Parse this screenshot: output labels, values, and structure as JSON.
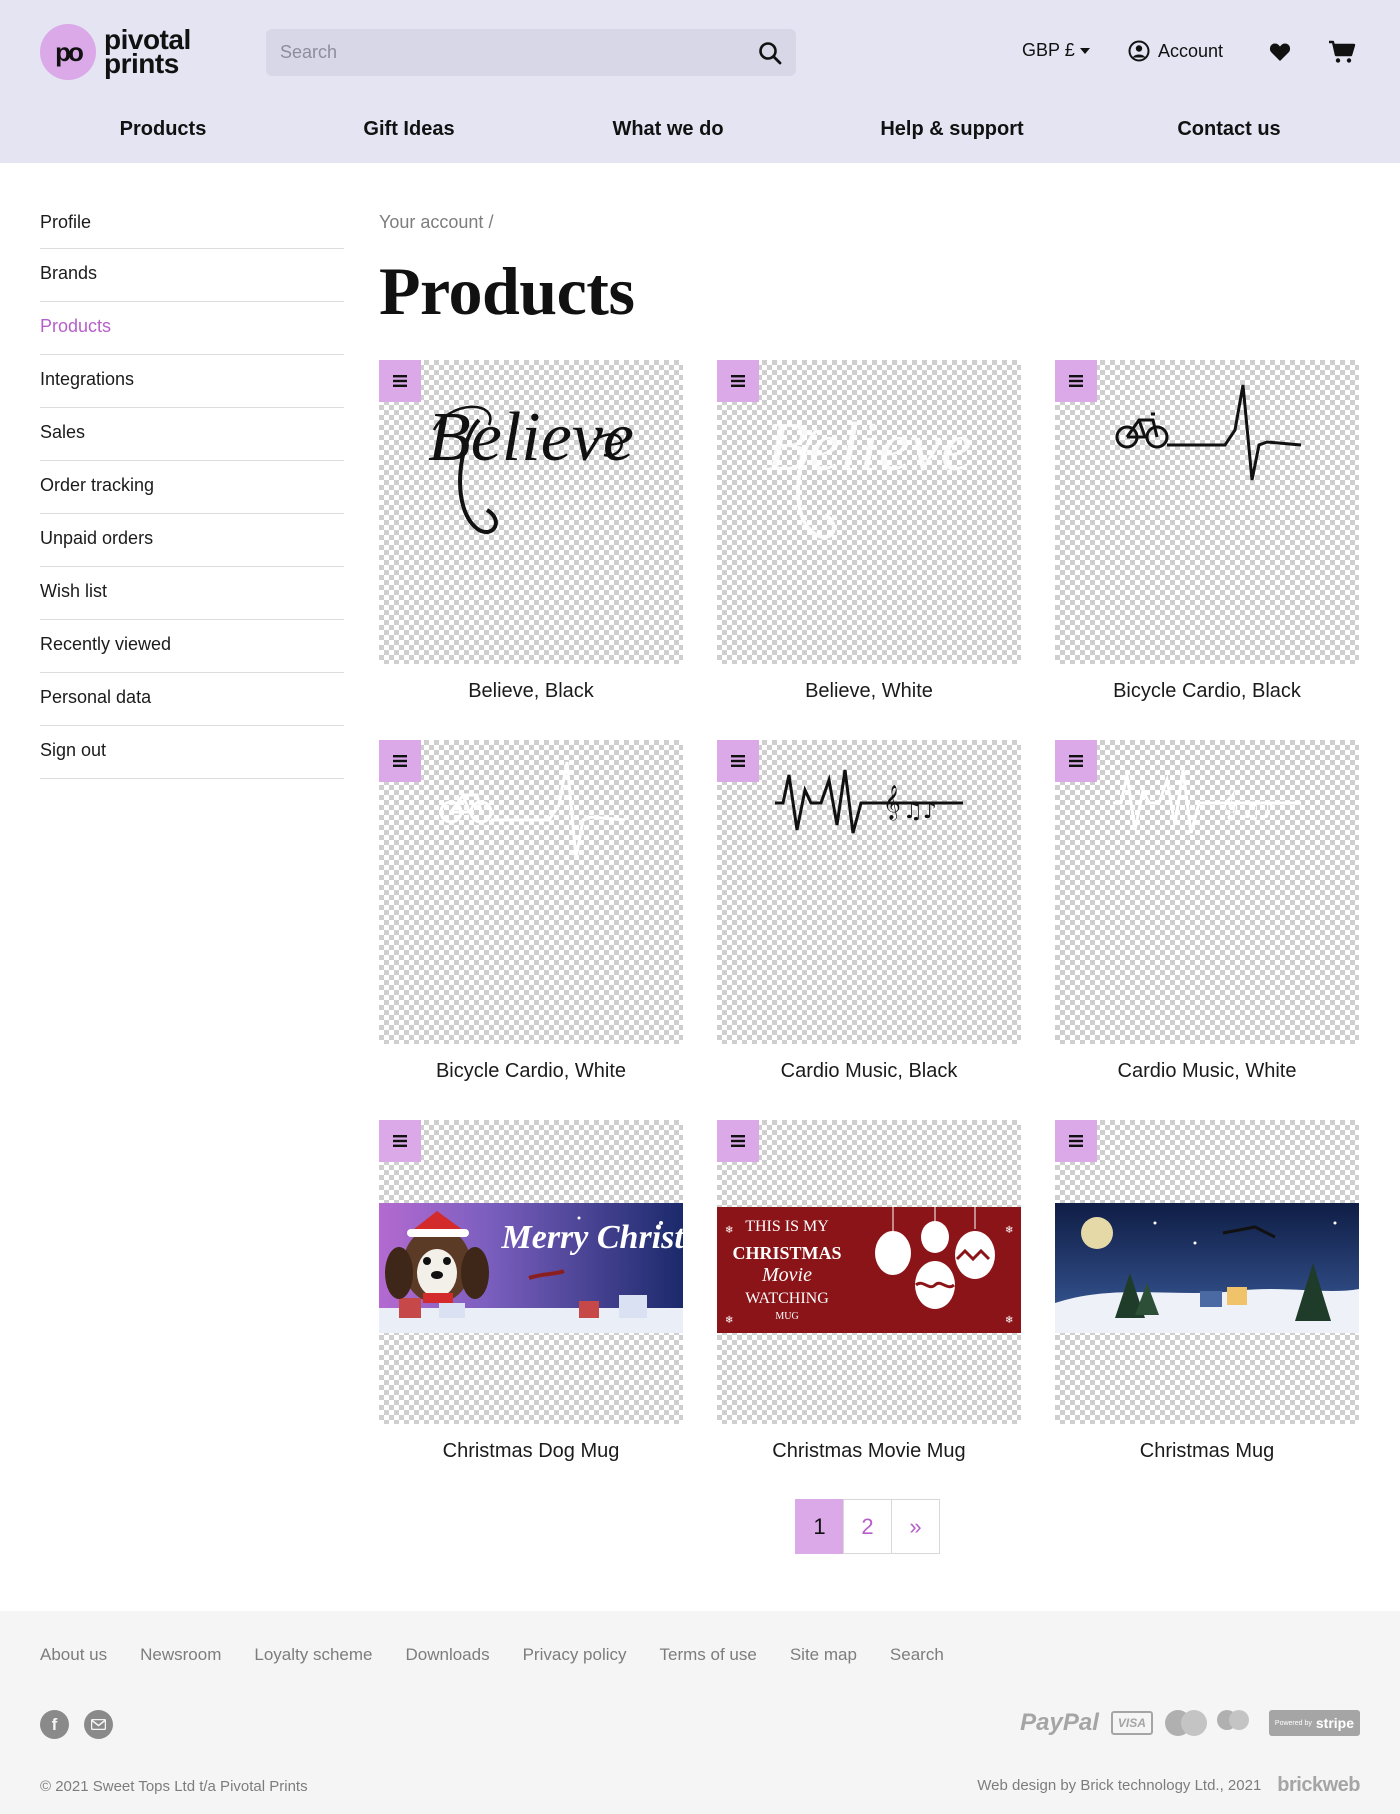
{
  "header": {
    "logo": {
      "line1": "pivotal",
      "line2": "prints",
      "mark": "po"
    },
    "search": {
      "placeholder": "Search",
      "value": ""
    },
    "currency": "GBP £",
    "account_label": "Account",
    "icons": [
      "search-icon",
      "user-circle-icon",
      "heart-icon",
      "cart-icon"
    ]
  },
  "nav": [
    {
      "label": "Products"
    },
    {
      "label": "Gift Ideas"
    },
    {
      "label": "What we do"
    },
    {
      "label": "Help & support"
    },
    {
      "label": "Contact us"
    }
  ],
  "sidebar": {
    "active": "Products",
    "items": [
      {
        "label": "Profile"
      },
      {
        "label": "Brands"
      },
      {
        "label": "Products"
      },
      {
        "label": "Integrations"
      },
      {
        "label": "Sales"
      },
      {
        "label": "Order tracking"
      },
      {
        "label": "Unpaid orders"
      },
      {
        "label": "Wish list"
      },
      {
        "label": "Recently viewed"
      },
      {
        "label": "Personal data"
      },
      {
        "label": "Sign out"
      }
    ]
  },
  "breadcrumb": {
    "parent": "Your account",
    "separator": "/"
  },
  "page_title": "Products",
  "products": [
    {
      "name": "Believe, Black",
      "design_text": "Believe",
      "design_color": "#111111"
    },
    {
      "name": "Believe, White",
      "design_text": "Believe",
      "design_color": "#ffffff"
    },
    {
      "name": "Bicycle Cardio, Black",
      "design_color": "#111111"
    },
    {
      "name": "Bicycle Cardio, White",
      "design_color": "#ffffff"
    },
    {
      "name": "Cardio Music, Black",
      "design_color": "#111111"
    },
    {
      "name": "Cardio Music, White",
      "design_color": "#ffffff"
    },
    {
      "name": "Christmas Dog Mug",
      "banner_text": "Merry Christmas"
    },
    {
      "name": "Christmas Movie Mug",
      "banner_lines": [
        "THIS IS MY",
        "CHRISTMAS",
        "Movie",
        "WATCHING",
        "MUG"
      ]
    },
    {
      "name": "Christmas Mug"
    }
  ],
  "pagination": {
    "pages": [
      "1",
      "2"
    ],
    "current": "1",
    "next": "»"
  },
  "footer": {
    "links": [
      {
        "label": "About us"
      },
      {
        "label": "Newsroom"
      },
      {
        "label": "Loyalty scheme"
      },
      {
        "label": "Downloads"
      },
      {
        "label": "Privacy policy"
      },
      {
        "label": "Terms of use"
      },
      {
        "label": "Site map"
      },
      {
        "label": "Search"
      }
    ],
    "social": [
      "facebook-icon",
      "email-icon"
    ],
    "payments": {
      "paypal": "PayPal",
      "visa": "VISA",
      "maestro": "maestro",
      "stripe_prefix": "Powered by",
      "stripe": "stripe"
    },
    "copyright": "© 2021 Sweet Tops Ltd t/a Pivotal Prints",
    "credit": "Web design by Brick technology Ltd., 2021",
    "credit_brand": "brickweb"
  },
  "colors": {
    "header_bg": "#e4e4f3",
    "accent": "#dba8e8",
    "active_link": "#b65fc9",
    "footer_bg": "#f5f5f5"
  }
}
